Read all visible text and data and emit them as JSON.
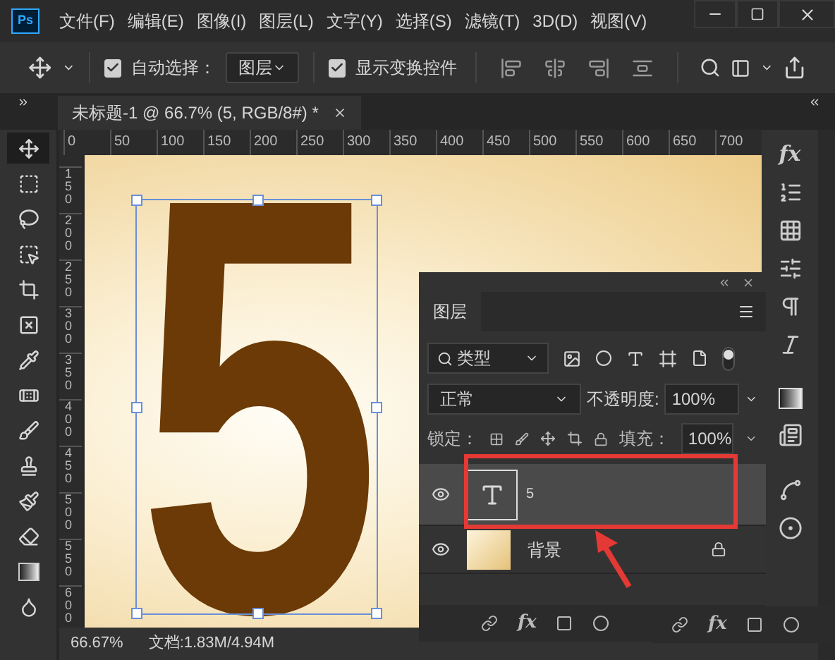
{
  "app_logo": "Ps",
  "menu": [
    "文件(F)",
    "编辑(E)",
    "图像(I)",
    "图层(L)",
    "文字(Y)",
    "选择(S)",
    "滤镜(T)",
    "3D(D)",
    "视图(V)"
  ],
  "options_bar": {
    "auto_select": {
      "label": "自动选择：",
      "checked": true
    },
    "auto_select_target": "图层",
    "show_transform": {
      "label": "显示变换控件",
      "checked": true
    }
  },
  "document_tab": {
    "title": "未标题-1 @ 66.7% (5, RGB/8#) *"
  },
  "rulers": {
    "horizontal": [
      "0",
      "50",
      "100",
      "150",
      "200",
      "250",
      "300",
      "350",
      "400",
      "450",
      "500",
      "550",
      "600",
      "650",
      "700"
    ],
    "vertical": [
      "150",
      "200",
      "250",
      "300",
      "350",
      "400",
      "450",
      "500",
      "550",
      "600"
    ]
  },
  "tools": [
    {
      "selected": true
    },
    {
      "selected": false
    },
    {
      "selected": false
    },
    {
      "selected": false
    },
    {
      "selected": false
    },
    {
      "selected": false
    },
    {
      "selected": false
    },
    {
      "selected": false
    },
    {
      "selected": false
    },
    {
      "selected": false
    },
    {
      "selected": false
    },
    {
      "selected": false
    },
    {
      "selected": false
    },
    {
      "selected": false
    }
  ],
  "canvas": {
    "text": "5"
  },
  "dock": {
    "fx": "fx"
  },
  "layers_panel": {
    "tab": "图层",
    "filter": "类型",
    "blend_mode": "正常",
    "opacity_label": "不透明度:",
    "opacity": "100%",
    "lock_label": "锁定：",
    "fill_label": "填充：",
    "fill": "100%",
    "layers": [
      {
        "kind": "text",
        "name": "5",
        "visible": true,
        "selected": true,
        "locked": false
      },
      {
        "kind": "image",
        "name": "背景",
        "visible": true,
        "selected": false,
        "locked": true
      }
    ],
    "footer_fx": "fx",
    "footer_fx_copy": "fx"
  },
  "status_bar": {
    "zoom": "66.67%",
    "doc": "文档:1.83M/4.94M"
  }
}
